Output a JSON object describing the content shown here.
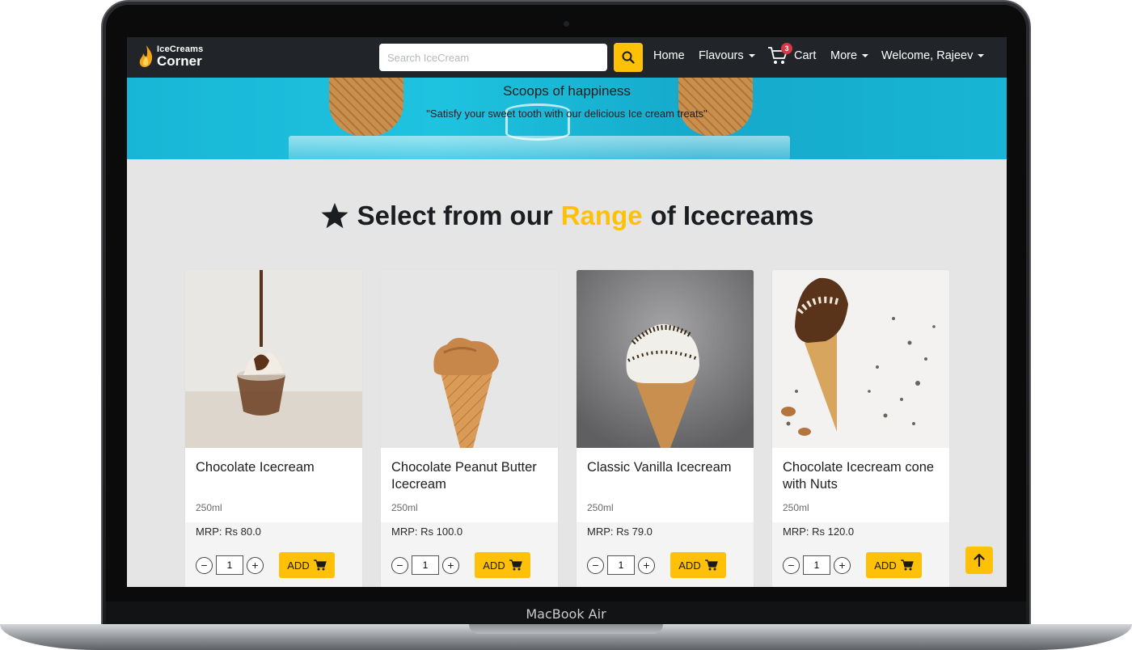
{
  "device": {
    "label": "MacBook Air"
  },
  "navbar": {
    "brand_line1": "IceCreams",
    "brand_line2": "Corner",
    "search_placeholder": "Search IceCream",
    "links": {
      "home": "Home",
      "flavours": "Flavours",
      "cart": "Cart",
      "cart_count": "3",
      "more": "More",
      "welcome": "Welcome, Rajeev"
    }
  },
  "hero": {
    "title": "Scoops of happiness",
    "caption": "\"Satisfy your sweet tooth with our delicious Ice cream treats\""
  },
  "section": {
    "title_before": "Select from our",
    "title_accent": "Range",
    "title_after": "of Icecreams",
    "accent_color": "#ffc107"
  },
  "products": [
    {
      "name": "Chocolate Icecream",
      "volume": "250ml",
      "price": "MRP: Rs 80.0",
      "qty": "1",
      "add_label": "ADD"
    },
    {
      "name": "Chocolate Peanut Butter Icecream",
      "volume": "250ml",
      "price": "MRP: Rs 100.0",
      "qty": "1",
      "add_label": "ADD"
    },
    {
      "name": "Classic Vanilla Icecream",
      "volume": "250ml",
      "price": "MRP: Rs 79.0",
      "qty": "1",
      "add_label": "ADD"
    },
    {
      "name": "Chocolate Icecream cone with Nuts",
      "volume": "250ml",
      "price": "MRP: Rs 120.0",
      "qty": "1",
      "add_label": "ADD"
    }
  ],
  "icons": {
    "search": "search-icon",
    "cart": "cart-icon",
    "star": "star-icon",
    "scroll_top": "arrow-up-icon"
  }
}
